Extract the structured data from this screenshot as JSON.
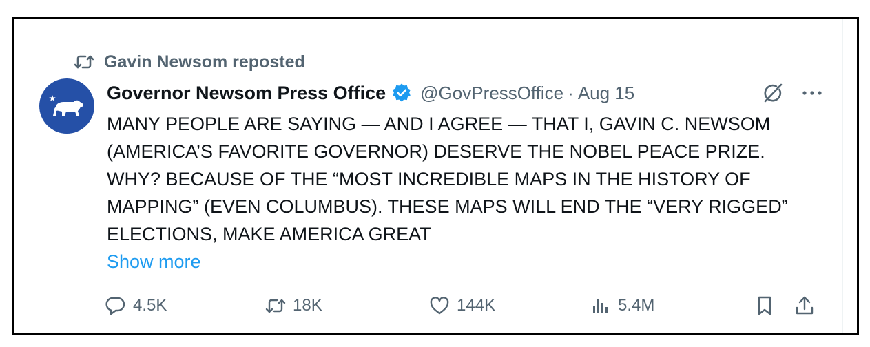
{
  "colors": {
    "text_primary": "#0f1419",
    "text_secondary": "#536471",
    "link": "#1d9bf0",
    "verified_badge": "#1d9bf0",
    "avatar_bg": "#2550a7",
    "frame_border": "#000000"
  },
  "repost": {
    "icon": "repost-icon",
    "label": "Gavin Newsom reposted"
  },
  "tweet": {
    "author": {
      "name": "Governor Newsom Press Office",
      "verified_icon": "verified-badge-icon",
      "handle": "@GovPressOffice",
      "separator": "·",
      "date": "Aug 15",
      "avatar_icon": "california-bear-icon"
    },
    "header_icons": [
      "grok-icon",
      "more-icon"
    ],
    "text": "MANY PEOPLE ARE SAYING — AND I AGREE — THAT I, GAVIN C. NEWSOM (AMERICA’S FAVORITE GOVERNOR) DESERVE THE NOBEL PEACE PRIZE. WHY? BECAUSE OF THE “MOST INCREDIBLE MAPS IN THE HISTORY OF MAPPING” (EVEN COLUMBUS). THESE MAPS WILL END THE “VERY RIGGED” ELECTIONS, MAKE AMERICA GREAT",
    "show_more": "Show more",
    "actions": {
      "reply": {
        "icon": "reply-icon",
        "count": "4.5K"
      },
      "repost": {
        "icon": "repost-icon",
        "count": "18K"
      },
      "like": {
        "icon": "heart-icon",
        "count": "144K"
      },
      "views": {
        "icon": "views-icon",
        "count": "5.4M"
      },
      "bookmark": {
        "icon": "bookmark-icon"
      },
      "share": {
        "icon": "share-icon"
      }
    }
  }
}
